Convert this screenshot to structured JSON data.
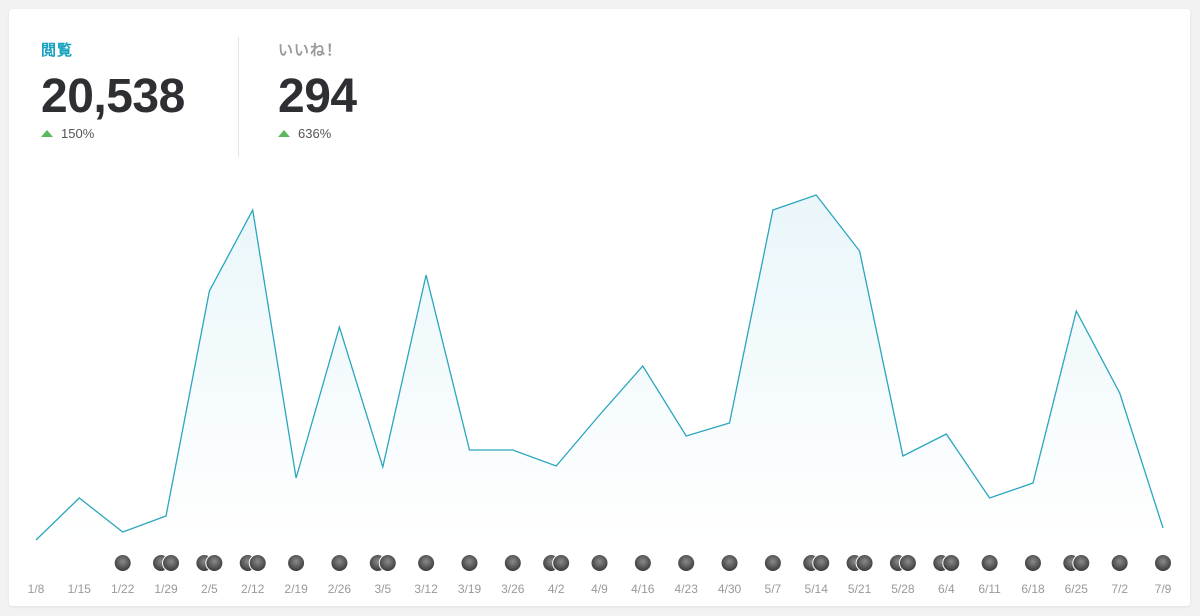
{
  "stats": {
    "views": {
      "label": "閲覧",
      "value": "20,538",
      "change": "150%"
    },
    "likes": {
      "label": "いいね！",
      "value": "294",
      "change": "636%"
    }
  },
  "colors": {
    "line": "#2aa6bd",
    "area_top": "#e9f6fa",
    "accent": "#17a2bf",
    "up": "#5cb85c",
    "tick_text": "#999999"
  },
  "chart_data": {
    "type": "area",
    "title": "",
    "xlabel": "",
    "ylabel": "",
    "grid": false,
    "categories": [
      "1/8",
      "1/15",
      "1/22",
      "1/29",
      "2/5",
      "2/12",
      "2/19",
      "2/26",
      "3/5",
      "3/12",
      "3/19",
      "3/26",
      "4/2",
      "4/9",
      "4/16",
      "4/23",
      "4/30",
      "5/7",
      "5/14",
      "5/21",
      "5/28",
      "6/4",
      "6/11",
      "6/18",
      "6/25",
      "7/2",
      "7/9"
    ],
    "tick_labels": [
      "1/8",
      "1/15",
      "1/22",
      "1/29",
      "2/5",
      "2/12",
      "2/19",
      "2/26",
      "3/5",
      "3/12",
      "3/19",
      "3/26",
      "4/2",
      "4/9",
      "4/16",
      "4/23",
      "4/30",
      "5/7",
      "5/14",
      "5/21",
      "5/28",
      "6/4",
      "6/11",
      "6/18",
      "6/25",
      "7/2",
      "7/9"
    ],
    "values": [
      1,
      43,
      9,
      25,
      250,
      331,
      63,
      214,
      74,
      266,
      91,
      91,
      75,
      126,
      175,
      105,
      118,
      331,
      346,
      290,
      85,
      107,
      43,
      58,
      230,
      148,
      13
    ],
    "ylim": [
      0,
      370
    ],
    "avatar_counts": [
      0,
      0,
      1,
      2,
      2,
      2,
      1,
      1,
      2,
      1,
      1,
      1,
      2,
      1,
      1,
      1,
      1,
      1,
      2,
      2,
      2,
      2,
      1,
      1,
      2,
      1,
      1
    ]
  }
}
